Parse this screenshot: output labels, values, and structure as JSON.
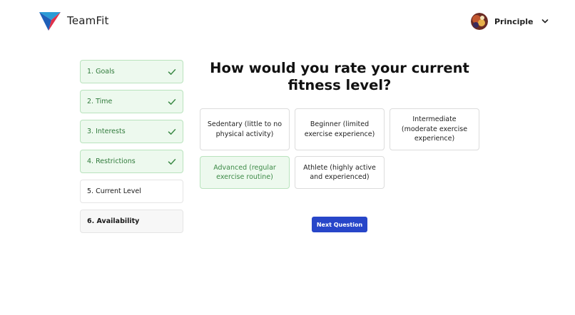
{
  "app": {
    "name": "TeamFit"
  },
  "user": {
    "name": "Principle",
    "avatar_icon": "user-avatar",
    "menu_icon": "chevron-down-icon"
  },
  "steps": [
    {
      "label": "1. Goals",
      "status": "done"
    },
    {
      "label": "2. Time",
      "status": "done"
    },
    {
      "label": "3. Interests",
      "status": "done"
    },
    {
      "label": "4. Restrictions",
      "status": "done"
    },
    {
      "label": "5. Current Level",
      "status": "current"
    },
    {
      "label": "6. Availability",
      "status": "pending"
    }
  ],
  "question": {
    "title": "How would you rate your current fitness level?"
  },
  "options": [
    {
      "label": "Sedentary (little to no physical activity)",
      "selected": false
    },
    {
      "label": "Beginner (limited exercise experience)",
      "selected": false
    },
    {
      "label": "Intermediate (moderate exercise experience)",
      "selected": false
    },
    {
      "label": "Advanced (regular exercise routine)",
      "selected": true
    },
    {
      "label": "Athlete (highly active and experienced)",
      "selected": false
    }
  ],
  "actions": {
    "next_label": "Next Question"
  },
  "colors": {
    "primary": "#2746c9",
    "success_bg": "#edf9ee",
    "success_border": "#b9e3bd",
    "success_text": "#2f7a3a"
  }
}
